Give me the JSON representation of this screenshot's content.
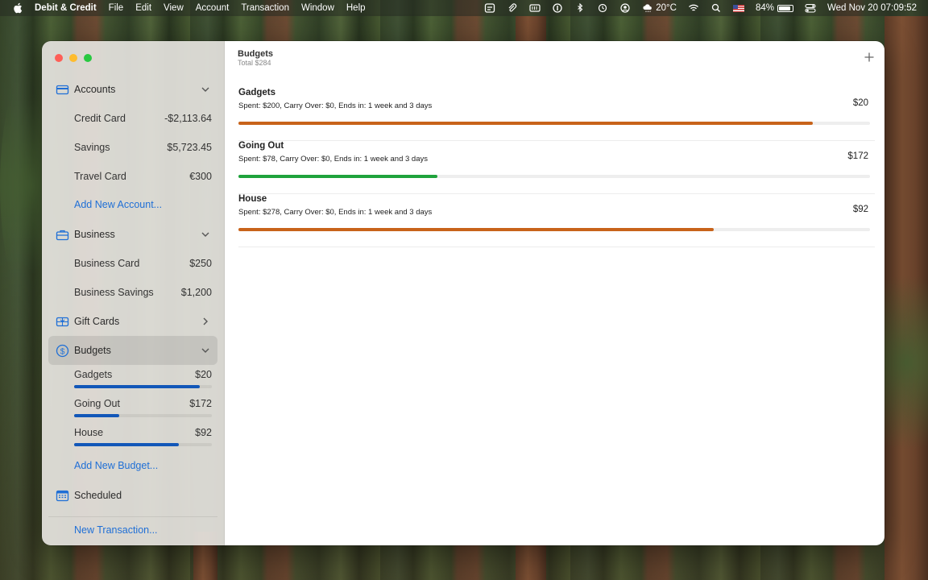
{
  "menubar": {
    "app_name": "Debit & Credit",
    "menus": [
      "File",
      "Edit",
      "View",
      "Account",
      "Transaction",
      "Window",
      "Help"
    ],
    "weather": "20°C",
    "battery": "84%",
    "datetime": "Wed Nov 20  07:09:52",
    "icons": [
      "tray-icon",
      "paperclip-icon",
      "memory-icon",
      "onepassword-icon",
      "bluetooth-icon",
      "time-machine-icon",
      "user-icon",
      "weather-icon",
      "wifi-icon",
      "spotlight-icon",
      "flag-icon",
      "battery-icon",
      "control-center-icon"
    ]
  },
  "sidebar": {
    "accounts": {
      "title": "Accounts",
      "icon": "credit-card-icon",
      "items": [
        {
          "label": "Credit Card",
          "amount": "-$2,113.64"
        },
        {
          "label": "Savings",
          "amount": "$5,723.45"
        },
        {
          "label": "Travel Card",
          "amount": "€300"
        }
      ],
      "add_label": "Add New Account..."
    },
    "business": {
      "title": "Business",
      "icon": "briefcase-icon",
      "items": [
        {
          "label": "Business Card",
          "amount": "$250"
        },
        {
          "label": "Business Savings",
          "amount": "$1,200"
        }
      ]
    },
    "gift_cards": {
      "title": "Gift Cards",
      "icon": "gift-icon"
    },
    "budgets": {
      "title": "Budgets",
      "icon": "dollar-circle-icon",
      "items": [
        {
          "label": "Gadgets",
          "amount": "$20",
          "progress": 0.91
        },
        {
          "label": "Going Out",
          "amount": "$172",
          "progress": 0.33
        },
        {
          "label": "House",
          "amount": "$92",
          "progress": 0.76
        }
      ],
      "add_label": "Add New Budget..."
    },
    "scheduled": {
      "title": "Scheduled",
      "icon": "calendar-icon"
    },
    "new_transaction": "New Transaction..."
  },
  "main": {
    "title": "Budgets",
    "subtitle": "Total $284",
    "budgets": [
      {
        "name": "Gadgets",
        "detail": "Spent: $200, Carry Over: $0, Ends in: 1 week and 3 days",
        "amount": "$20",
        "progress": 0.91,
        "color": "#c8631a"
      },
      {
        "name": "Going Out",
        "detail": "Spent: $78, Carry Over: $0, Ends in: 1 week and 3 days",
        "amount": "$172",
        "progress": 0.315,
        "color": "#1fa33c"
      },
      {
        "name": "House",
        "detail": "Spent: $278, Carry Over: $0, Ends in: 1 week and 3 days",
        "amount": "$92",
        "progress": 0.752,
        "color": "#c8631a"
      }
    ]
  }
}
